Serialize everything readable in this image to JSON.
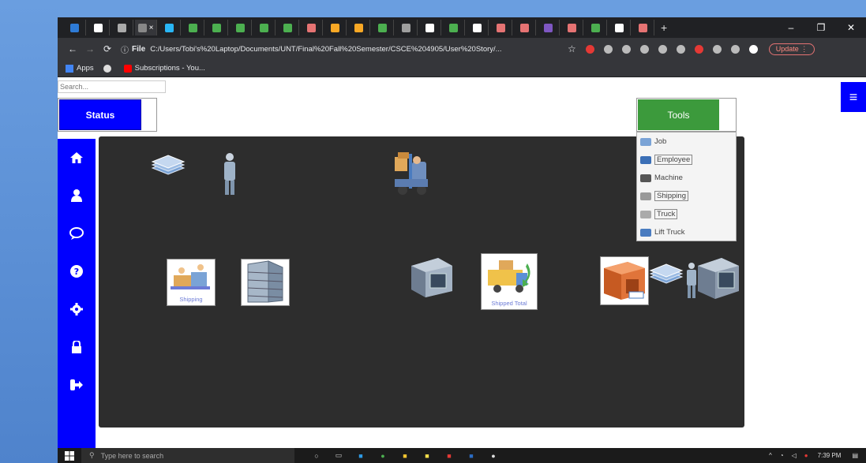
{
  "browser": {
    "tab_icon_colors": [
      "#2e7bd6",
      "#fff",
      "#aaa",
      "#888",
      "#29b6f6",
      "#4caf50",
      "#4caf50",
      "#4caf50",
      "#4caf50",
      "#4caf50",
      "#e57373",
      "#f9a825",
      "#f9a825",
      "#4caf50",
      "#9e9e9e",
      "#fff",
      "#4caf50",
      "#fff",
      "#e57373",
      "#e57373",
      "#7e57c2",
      "#e57373",
      "#4caf50",
      "#fff",
      "#e57373"
    ],
    "active_tab_close": "×",
    "new_tab": "+",
    "window_controls": [
      "–",
      "❐",
      "✕"
    ],
    "file_label": "File",
    "url": "C:/Users/Tobi's%20Laptop/Documents/UNT/Final%20Fall%20Semester/CSCE%204905/User%20Story/...",
    "update_label": "Update ⋮",
    "bookmarks": [
      {
        "label": "Apps",
        "icon": "apps-grid-icon",
        "color": "#4285f4"
      },
      {
        "label": "",
        "icon": "globe-icon",
        "color": "#ddd"
      },
      {
        "label": "Subscriptions - You...",
        "icon": "youtube-icon",
        "color": "#ff0000"
      }
    ]
  },
  "page": {
    "search_placeholder": "Search...",
    "status_label": "Status",
    "tools_label": "Tools",
    "tools_menu": [
      {
        "label": "Job",
        "icon": "job-icon",
        "color": "#7aa3d6",
        "boxed": false
      },
      {
        "label": "Employee",
        "icon": "employee-icon",
        "color": "#3b6fb6",
        "boxed": true
      },
      {
        "label": "Machine",
        "icon": "machine-icon",
        "color": "#555",
        "boxed": false
      },
      {
        "label": "Shipping",
        "icon": "shipping-icon",
        "color": "#999",
        "boxed": true
      },
      {
        "label": "Truck",
        "icon": "truck-icon",
        "color": "#aaa",
        "boxed": true
      },
      {
        "label": "Lift Truck",
        "icon": "lift-truck-icon",
        "color": "#4a7cc0",
        "boxed": false
      }
    ],
    "sidebar": [
      {
        "icon": "home-icon"
      },
      {
        "icon": "user-icon"
      },
      {
        "icon": "chat-icon"
      },
      {
        "icon": "help-icon"
      },
      {
        "icon": "settings-icon"
      },
      {
        "icon": "lock-icon"
      },
      {
        "icon": "logout-icon"
      }
    ],
    "canvas_nodes": [
      {
        "name": "job-stack-node",
        "caption": ""
      },
      {
        "name": "employee-node",
        "caption": ""
      },
      {
        "name": "lift-truck-node",
        "caption": ""
      },
      {
        "name": "shipping-node",
        "caption": "Shipping"
      },
      {
        "name": "storage-rack-node",
        "caption": ""
      },
      {
        "name": "machine-node",
        "caption": ""
      },
      {
        "name": "truck-shipped-node",
        "caption": "Shipped Total"
      },
      {
        "name": "warehouse-node",
        "caption": ""
      },
      {
        "name": "workstation-group-node",
        "caption": ""
      }
    ]
  },
  "taskbar": {
    "search_placeholder": "Type here to search",
    "time": "7:39 PM"
  }
}
